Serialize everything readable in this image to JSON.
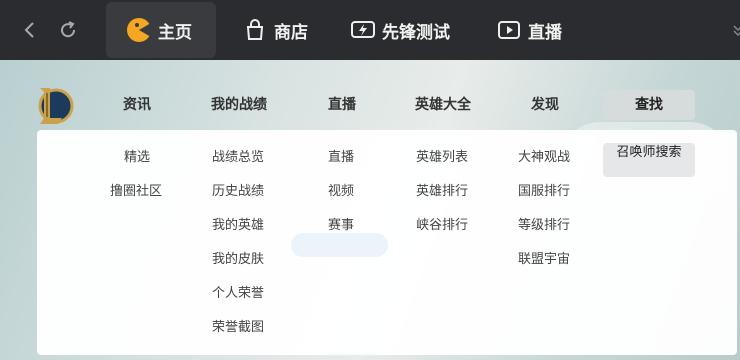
{
  "topbar": {
    "tabs": [
      {
        "label": "主页",
        "icon": "home-icon"
      },
      {
        "label": "商店",
        "icon": "bag-icon"
      },
      {
        "label": "先锋测试",
        "icon": "lightning-icon"
      },
      {
        "label": "直播",
        "icon": "play-icon"
      }
    ]
  },
  "nav": {
    "items": [
      "资讯",
      "我的战绩",
      "直播",
      "英雄大全",
      "发现",
      "查找"
    ]
  },
  "dropdown": {
    "news": [
      "精选",
      "撸圈社区"
    ],
    "battle": [
      "战绩总览",
      "历史战绩",
      "我的英雄",
      "我的皮肤",
      "个人荣誉",
      "荣誉截图"
    ],
    "live": [
      "直播",
      "视频",
      "赛事"
    ],
    "heroes": [
      "英雄列表",
      "英雄排行",
      "峡谷排行"
    ],
    "find": [
      "大神观战",
      "国服排行",
      "等级排行",
      "联盟宇宙"
    ],
    "search": [
      "召唤师搜索"
    ]
  },
  "colors": {
    "topbar": "#2b2c2f",
    "active_tab": "#3a3b3f",
    "accent": "#f5a623"
  }
}
